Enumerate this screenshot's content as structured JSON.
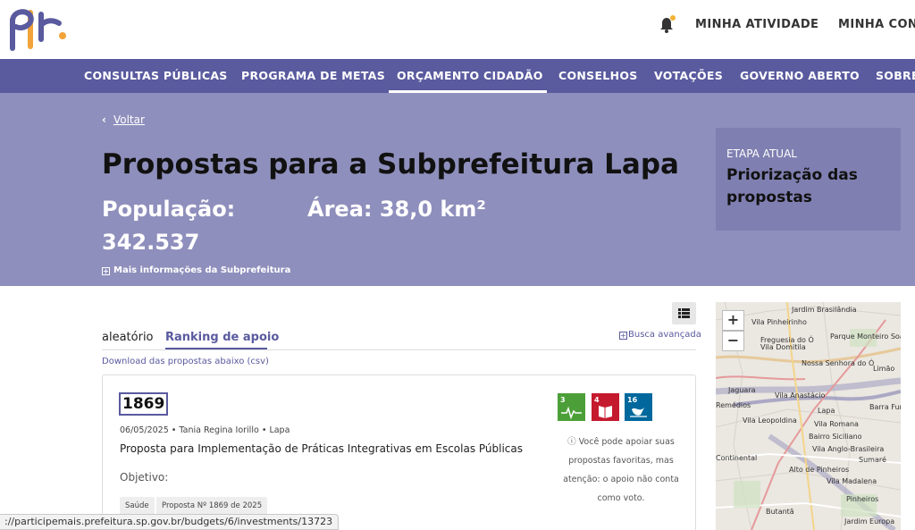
{
  "header": {
    "logo_text": "pl",
    "links": [
      "MINHA ATIVIDADE",
      "MINHA CONT"
    ]
  },
  "nav": {
    "items": [
      "CONSULTAS PÚBLICAS",
      "PROGRAMA DE METAS",
      "ORÇAMENTO CIDADÃO",
      "CONSELHOS",
      "VOTAÇÕES",
      "GOVERNO ABERTO",
      "SOBRE"
    ],
    "active": "ORÇAMENTO CIDADÃO"
  },
  "hero": {
    "back_label": "Voltar",
    "back_chevron": "‹",
    "title": "Propostas para a Subprefeitura Lapa",
    "population_label": "População:",
    "population_value": "342.537",
    "area": "Área: 38,0 km²",
    "more_info": "Mais informações da Subprefeitura",
    "stage_label": "ETAPA ATUAL",
    "stage_value": "Priorização das propostas"
  },
  "listing": {
    "tabs": [
      "aleatório",
      "Ranking de apoio"
    ],
    "active_tab": "Ranking de apoio",
    "advanced_search": "Busca avançada",
    "download": "Download das propostas abaixo (csv)"
  },
  "proposal": {
    "id": "1869",
    "date": "06/05/2025",
    "author": "Tania Regina Iorillo",
    "district": "Lapa",
    "title": "Proposta para Implementação de Práticas Integrativas em Escolas Públicas",
    "objective_label": "Objetivo:",
    "tags": [
      "Saúde",
      "Proposta Nº 1869 de 2025"
    ],
    "support_note": "Você pode apoiar suas propostas favoritas, mas atenção: o apoio não conta como voto.",
    "ods": [
      {
        "number": "3",
        "color": "#4c9f38",
        "icon": "heartbeat-icon"
      },
      {
        "number": "4",
        "color": "#c5192d",
        "icon": "book-icon"
      },
      {
        "number": "16",
        "color": "#00689d",
        "icon": "dove-icon"
      }
    ]
  },
  "map": {
    "zoom_in": "+",
    "zoom_out": "−",
    "labels": [
      "Jardim Brasilândia",
      "Vila Pinheirinho",
      "Parque Monteiro Soares",
      "Freguesia do Ó",
      "Nossa Senhora do Ó",
      "Limão",
      "Jaguara",
      "Vila Anastácio",
      "Barra Fun",
      "Lapa",
      "Vila Leopoldina",
      "Vila Romana",
      "Bairro Siciliano",
      "Vila Anglo-Brasileira",
      "Sumaré",
      "Continental",
      "Alto de Pinheiros",
      "Vila Madalena",
      "Pinheiros",
      "Butantã",
      "Jardim Europa",
      "Remédios",
      "Vila Domitila"
    ]
  },
  "status_url": "://participemais.prefeitura.sp.gov.br/budgets/6/investments/13723",
  "colors": {
    "brand": "#5a5a9f",
    "hero": "#8f8fbd",
    "stage_box": "#7f7fb1",
    "logo_orange": "#f2a33a"
  }
}
